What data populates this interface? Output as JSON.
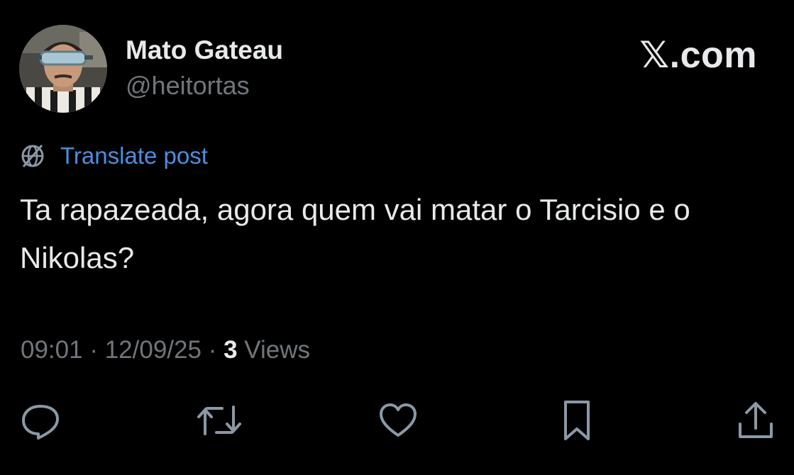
{
  "author": {
    "display_name": "Mato Gateau",
    "handle": "@heitortas"
  },
  "brand": "𝕏.com",
  "translate": {
    "icon": "globe-icon",
    "label": "Translate post"
  },
  "post": {
    "text": "Ta rapazeada, agora quem vai matar o Tarcisio e o Nikolas?"
  },
  "meta": {
    "time": "09:01",
    "separator": "·",
    "date": "12/09/25",
    "views_count": "3",
    "views_label": "Views"
  },
  "actions": [
    {
      "name": "reply",
      "icon": "reply-icon"
    },
    {
      "name": "repost",
      "icon": "repost-icon"
    },
    {
      "name": "like",
      "icon": "heart-icon"
    },
    {
      "name": "bookmark",
      "icon": "bookmark-icon"
    },
    {
      "name": "share",
      "icon": "share-icon"
    }
  ],
  "colors": {
    "background": "#000000",
    "primary_text": "#e7e9ea",
    "secondary_text": "#71767b",
    "link": "#4a8fe0",
    "icon": "#8b98a5"
  }
}
